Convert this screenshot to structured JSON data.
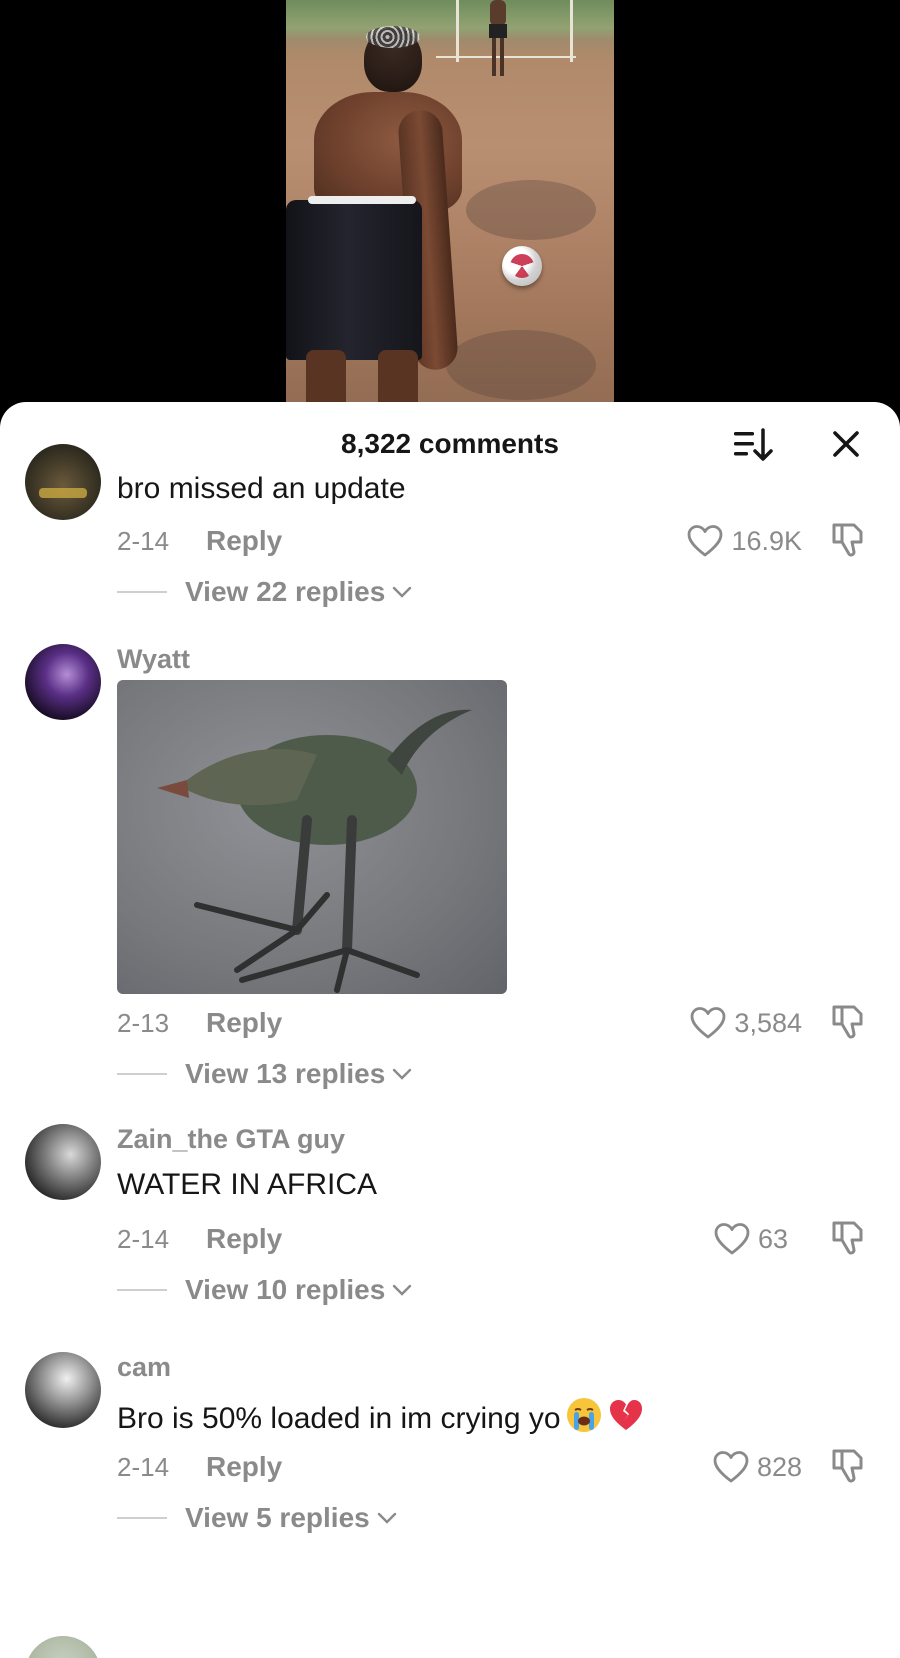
{
  "sheet": {
    "title": "8,322 comments",
    "sort_icon": "sort-descending-icon",
    "close_icon": "close-icon"
  },
  "comments": [
    {
      "username": "",
      "text": "bro missed an update",
      "date": "2-14",
      "reply_label": "Reply",
      "likes": "16.9K",
      "view_replies": "View 22 replies"
    },
    {
      "username": "Wyatt",
      "text": "",
      "has_image": true,
      "date": "2-13",
      "reply_label": "Reply",
      "likes": "3,584",
      "view_replies": "View 13 replies"
    },
    {
      "username": "Zain_the GTA guy",
      "text": "WATER IN AFRICA",
      "date": "2-14",
      "reply_label": "Reply",
      "likes": "63",
      "view_replies": "View 10 replies"
    },
    {
      "username": "cam",
      "text": "Bro is 50% loaded in im crying yo",
      "emojis": [
        "loudly-crying-face-emoji",
        "broken-heart-emoji"
      ],
      "date": "2-14",
      "reply_label": "Reply",
      "likes": "828",
      "view_replies": "View 5 replies"
    }
  ],
  "colors": {
    "background_top": "#000000",
    "sheet": "#ffffff",
    "muted_text": "#8a8a8a",
    "primary_text": "#161616"
  }
}
